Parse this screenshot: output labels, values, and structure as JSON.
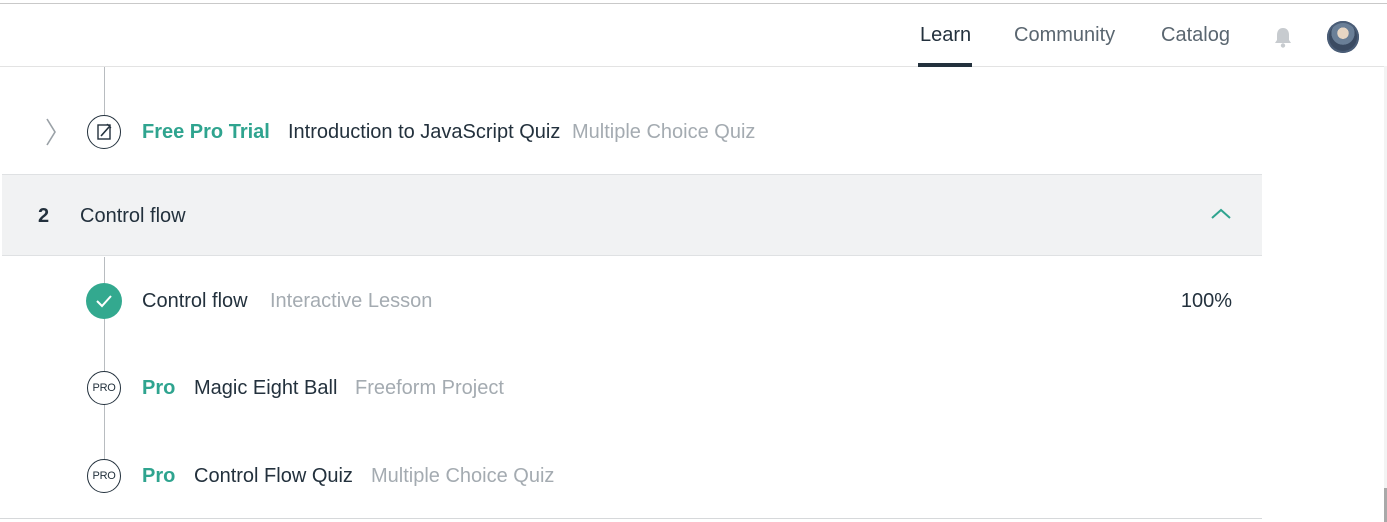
{
  "nav": {
    "links": [
      {
        "label": "Learn",
        "active": true
      },
      {
        "label": "Community",
        "active": false
      },
      {
        "label": "Catalog",
        "active": false
      }
    ],
    "icons": [
      "bell-icon",
      "avatar"
    ]
  },
  "module1_last": {
    "badge": "Free Pro Trial",
    "title": "Introduction to JavaScript Quiz",
    "type": "Multiple Choice Quiz",
    "icon": "quiz-edit-icon"
  },
  "section2": {
    "number": "2",
    "title": "Control flow",
    "expanded": true
  },
  "items": [
    {
      "status": "completed",
      "title": "Control flow",
      "type": "Interactive Lesson",
      "progress": "100%"
    },
    {
      "status": "pro",
      "icon_text": "PRO",
      "badge": "Pro",
      "title": "Magic Eight Ball",
      "type": "Freeform Project"
    },
    {
      "status": "pro",
      "icon_text": "PRO",
      "badge": "Pro",
      "title": "Control Flow Quiz",
      "type": "Multiple Choice Quiz"
    }
  ],
  "colors": {
    "accent": "#2fa48f",
    "text": "#23313d",
    "muted": "#a4abb1",
    "section_bg": "#f1f2f3"
  }
}
